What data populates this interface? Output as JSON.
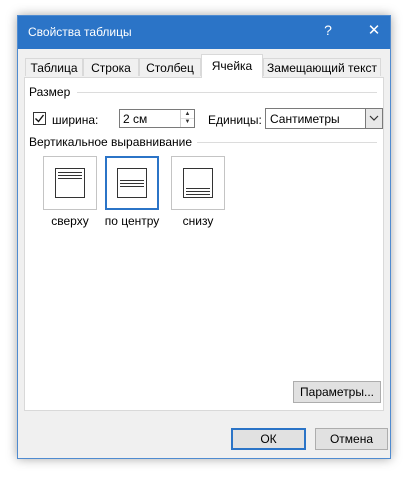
{
  "window": {
    "title": "Свойства таблицы",
    "help_glyph": "?",
    "close_glyph": "✕"
  },
  "tabs": [
    {
      "label": "Таблица",
      "active": false
    },
    {
      "label": "Строка",
      "active": false
    },
    {
      "label": "Столбец",
      "active": false
    },
    {
      "label": "Ячейка",
      "active": true
    },
    {
      "label": "Замещающий текст",
      "active": false
    }
  ],
  "size_group": {
    "title": "Размер",
    "width_checkbox_checked": true,
    "width_label": "ширина:",
    "width_value": "2 см",
    "units_label": "Единицы:",
    "units_value": "Сантиметры"
  },
  "valign_group": {
    "title": "Вертикальное выравнивание",
    "options": [
      {
        "label": "сверху",
        "selected": false
      },
      {
        "label": "по центру",
        "selected": true
      },
      {
        "label": "снизу",
        "selected": false
      }
    ]
  },
  "buttons": {
    "params_label": "Параметры...",
    "ok_label": "ОК",
    "cancel_label": "Отмена"
  },
  "colors": {
    "title_bar": "#2b74c7",
    "selection": "#2b74c7"
  }
}
